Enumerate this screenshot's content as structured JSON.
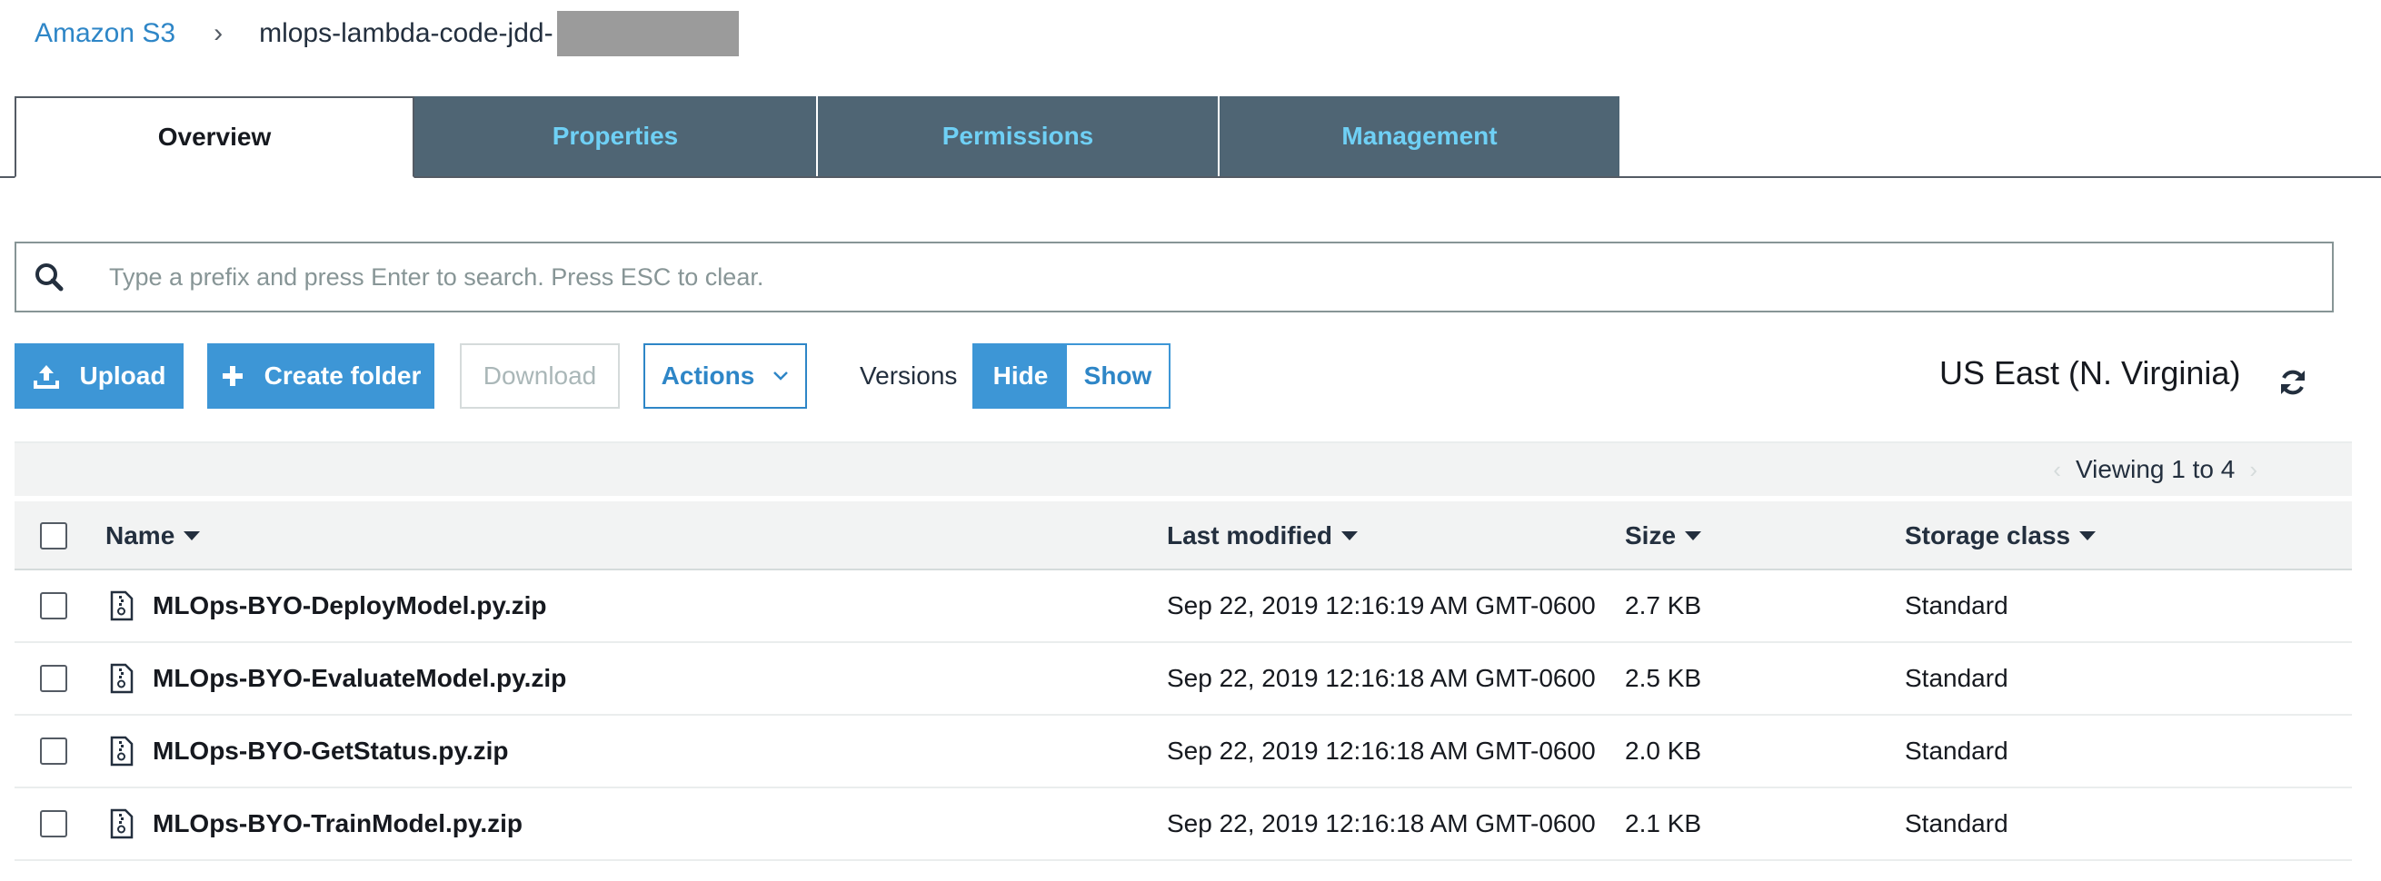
{
  "breadcrumb": {
    "root": "Amazon S3",
    "separator": "›",
    "bucket": "mlops-lambda-code-jdd-"
  },
  "tabs": [
    {
      "label": "Overview",
      "active": true
    },
    {
      "label": "Properties",
      "active": false
    },
    {
      "label": "Permissions",
      "active": false
    },
    {
      "label": "Management",
      "active": false
    }
  ],
  "search": {
    "placeholder": "Type a prefix and press Enter to search. Press ESC to clear.",
    "icon": "search-icon"
  },
  "toolbar": {
    "upload_label": "Upload",
    "create_folder_label": "Create folder",
    "download_label": "Download",
    "actions_label": "Actions",
    "versions_label": "Versions",
    "hide_label": "Hide",
    "show_label": "Show"
  },
  "region": "US East (N. Virginia)",
  "table": {
    "viewing": "Viewing 1 to 4",
    "columns": {
      "name": "Name",
      "last_modified": "Last modified",
      "size": "Size",
      "storage_class": "Storage class"
    },
    "rows": [
      {
        "name": "MLOps-BYO-DeployModel.py.zip",
        "last_modified": "Sep 22, 2019 12:16:19 AM GMT-0600",
        "size": "2.7 KB",
        "storage_class": "Standard"
      },
      {
        "name": "MLOps-BYO-EvaluateModel.py.zip",
        "last_modified": "Sep 22, 2019 12:16:18 AM GMT-0600",
        "size": "2.5 KB",
        "storage_class": "Standard"
      },
      {
        "name": "MLOps-BYO-GetStatus.py.zip",
        "last_modified": "Sep 22, 2019 12:16:18 AM GMT-0600",
        "size": "2.0 KB",
        "storage_class": "Standard"
      },
      {
        "name": "MLOps-BYO-TrainModel.py.zip",
        "last_modified": "Sep 22, 2019 12:16:18 AM GMT-0600",
        "size": "2.1 KB",
        "storage_class": "Standard"
      }
    ]
  },
  "colors": {
    "primary": "#3d96d6",
    "tab_inactive_bg": "#4f6574",
    "tab_inactive_text": "#6fd0f5",
    "link": "#2e86c7"
  }
}
